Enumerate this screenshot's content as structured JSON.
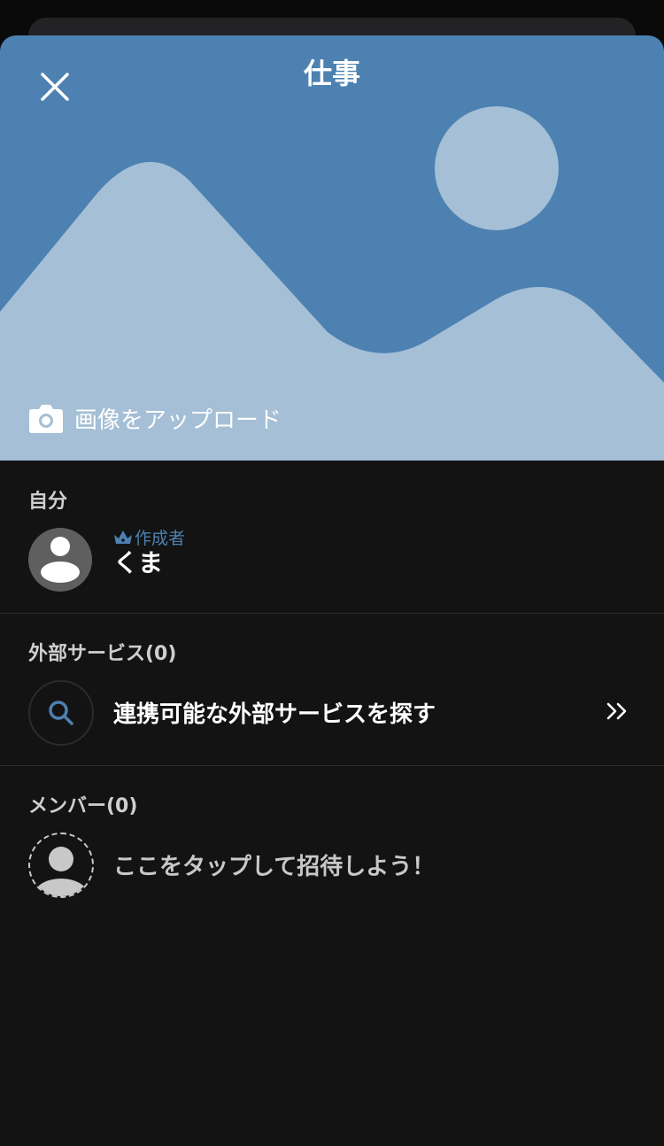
{
  "header": {
    "title": "仕事",
    "upload_label": "画像をアップロード"
  },
  "self_section": {
    "label": "自分",
    "creator_badge": "作成者",
    "user_name": "くま"
  },
  "external_section": {
    "label": "外部サービス(0)",
    "find_label": "連携可能な外部サービスを探す"
  },
  "members_section": {
    "label": "メンバー(0)",
    "invite_label": "ここをタップして招待しよう！"
  },
  "colors": {
    "hero_bg": "#4c81b1",
    "hero_shape": "#a4bfd6",
    "accent": "#4c81b1",
    "background": "#131313"
  },
  "icons": {
    "close": "close-icon",
    "camera": "camera-icon",
    "crown": "crown-icon",
    "search": "search-icon",
    "chevron": "double-chevron-right-icon",
    "avatar": "person-icon"
  }
}
